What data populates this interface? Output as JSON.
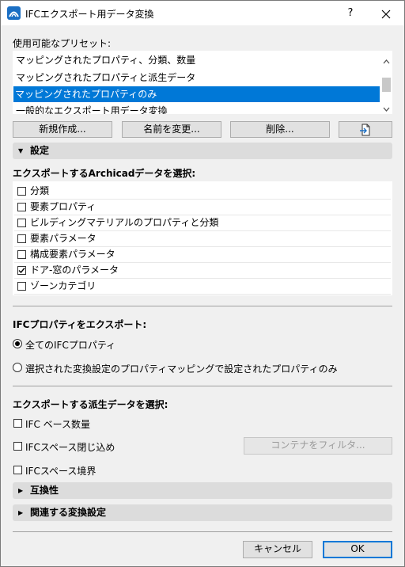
{
  "window": {
    "title": "IFCエクスポート用データ変換",
    "help_label": "?",
    "close_label": "✕"
  },
  "presets": {
    "label": "使用可能なプリセット:",
    "items": [
      "マッピングされたプロパティ、分類、数量",
      "マッピングされたプロパティと派生データ",
      "マッピングされたプロパティのみ",
      "一般的なエクスポート用データ変換"
    ],
    "selected_index": 2,
    "buttons": {
      "new": "新規作成...",
      "rename": "名前を変更...",
      "delete": "削除...",
      "import_icon": "import-icon"
    }
  },
  "settings": {
    "section_title": "設定",
    "archicad_data_label": "エクスポートするArchicadデータを選択:",
    "archicad_items": [
      {
        "label": "分類",
        "checked": false
      },
      {
        "label": "要素プロパティ",
        "checked": false
      },
      {
        "label": "ビルディングマテリアルのプロパティと分類",
        "checked": false
      },
      {
        "label": "要素パラメータ",
        "checked": false
      },
      {
        "label": "構成要素パラメータ",
        "checked": false
      },
      {
        "label": "ドア-窓のパラメータ",
        "checked": true
      },
      {
        "label": "ゾーンカテゴリ",
        "checked": false
      }
    ],
    "ifc_props_label": "IFCプロパティをエクスポート:",
    "ifc_props_options": [
      {
        "label": "全てのIFCプロパティ",
        "selected": true
      },
      {
        "label": "選択された変換設定のプロパティマッピングで設定されたプロパティのみ",
        "selected": false
      }
    ],
    "derived_label": "エクスポートする派生データを選択:",
    "derived_items": [
      {
        "label": "IFC ベース数量",
        "checked": false
      },
      {
        "label": "IFCスペース閉じ込め",
        "checked": false
      },
      {
        "label": "IFCスペース境界",
        "checked": false
      }
    ],
    "filter_button": "コンテナをフィルタ..."
  },
  "compatibility": {
    "section_title": "互換性"
  },
  "related": {
    "section_title": "関連する変換設定"
  },
  "footer": {
    "cancel": "キャンセル",
    "ok": "OK"
  }
}
